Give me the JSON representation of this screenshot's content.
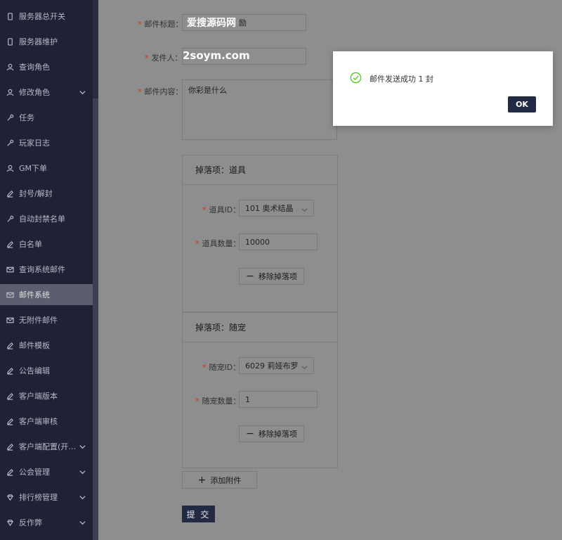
{
  "sidebar": {
    "items": [
      {
        "label": "服务器总开关",
        "icon": "phone-icon"
      },
      {
        "label": "服务器维护",
        "icon": "phone-icon"
      },
      {
        "label": "查询角色",
        "icon": "user-icon"
      },
      {
        "label": "修改角色",
        "icon": "user-icon",
        "expand": true
      },
      {
        "label": "任务",
        "icon": "wrench-icon"
      },
      {
        "label": "玩家日志",
        "icon": "wrench-icon"
      },
      {
        "label": "GM下单",
        "icon": "user-icon"
      },
      {
        "label": "封号/解封",
        "icon": "edit-icon"
      },
      {
        "label": "自动封禁名单",
        "icon": "wrench-icon"
      },
      {
        "label": "白名单",
        "icon": "edit-icon"
      },
      {
        "label": "查询系统邮件",
        "icon": "mail-icon"
      },
      {
        "label": "邮件系统",
        "icon": "mail-icon",
        "active": true
      },
      {
        "label": "无附件邮件",
        "icon": "mail-icon"
      },
      {
        "label": "邮件模板",
        "icon": "edit-icon"
      },
      {
        "label": "公告编辑",
        "icon": "edit-icon"
      },
      {
        "label": "客户端版本",
        "icon": "edit-icon"
      },
      {
        "label": "客户端审核",
        "icon": "edit-icon"
      },
      {
        "label": "客户端配置(开…",
        "icon": "edit-icon",
        "expand": true
      },
      {
        "label": "公会管理",
        "icon": "edit-icon",
        "expand": true
      },
      {
        "label": "排行榜管理",
        "icon": "diamond-icon",
        "expand": true
      },
      {
        "label": "反作弊",
        "icon": "diamond-icon",
        "expand": true
      }
    ]
  },
  "form": {
    "subject_label": "邮件标题：",
    "subject_value": "励",
    "sender_label": "发件人：",
    "sender_value": "",
    "content_label": "邮件内容：",
    "content_value": "你彩是什么"
  },
  "watermark": {
    "line1": "爱搜源码网",
    "line2": "2soym.com"
  },
  "drops": [
    {
      "title": "掉落项：道具",
      "id_label": "道具ID：",
      "id_value": "101 奥术结晶",
      "qty_label": "道具数量：",
      "qty_value": "10000",
      "remove_label": "移除掉落项"
    },
    {
      "title": "掉落项：随宠",
      "id_label": "随宠ID：",
      "id_value": "6029 莉娅布罗",
      "qty_label": "随宠数量：",
      "qty_value": "1",
      "remove_label": "移除掉落项"
    }
  ],
  "add_attachment_label": "添加附件",
  "submit_label": "提 交",
  "modal": {
    "message": "邮件发送成功 1 封",
    "ok_label": "OK"
  },
  "colors": {
    "sidebar_bg": "#1f2237",
    "primary": "#222a44",
    "success": "#52c41a",
    "required": "#c0392b"
  }
}
